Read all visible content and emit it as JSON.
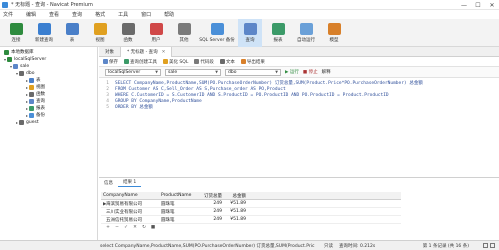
{
  "window": {
    "title": "* 无标题 - 查询 - Navicat Premium",
    "controls": [
      "—",
      "☐",
      "✕"
    ]
  },
  "menu": [
    "文件",
    "编辑",
    "查看",
    "查询",
    "格式",
    "工具",
    "窗口",
    "帮助"
  ],
  "toolbar": [
    {
      "label": "连接",
      "color": "#2e8b3e"
    },
    {
      "label": "新建查询",
      "color": "#3b7fd0"
    },
    {
      "label": "表",
      "color": "#4a7fc8"
    },
    {
      "label": "视图",
      "color": "#e0a020"
    },
    {
      "label": "函数",
      "color": "#6a6a6a"
    },
    {
      "label": "用户",
      "color": "#d04848"
    },
    {
      "label": "其他",
      "color": "#7a7a7a"
    },
    {
      "label": "SQL Server 备份",
      "color": "#4a8fd8"
    },
    {
      "label": "查询",
      "color": "#5c86c8"
    },
    {
      "label": "报表",
      "color": "#3b9a68"
    },
    {
      "label": "自动运行",
      "color": "#6aa0d8"
    },
    {
      "label": "模型",
      "color": "#d8802a"
    }
  ],
  "tree": [
    {
      "label": "本地数据库",
      "level": 0,
      "color": "#2e8b3e"
    },
    {
      "label": "localSqlServer",
      "level": 0,
      "color": "#2e8b3e"
    },
    {
      "label": "sale",
      "level": 1,
      "color": "#5c86c8"
    },
    {
      "label": "dbo",
      "level": 2,
      "color": "#6a6a6a"
    },
    {
      "label": "表",
      "level": 3,
      "color": "#4a7fc8"
    },
    {
      "label": "视图",
      "level": 3,
      "color": "#e0a020"
    },
    {
      "label": "函数",
      "level": 3,
      "color": "#6a6a6a"
    },
    {
      "label": "查询",
      "level": 3,
      "color": "#5c86c8"
    },
    {
      "label": "报表",
      "level": 3,
      "color": "#3b9a68"
    },
    {
      "label": "备份",
      "level": 3,
      "color": "#4a8fd8"
    },
    {
      "label": "guest",
      "level": 2,
      "color": "#6a6a6a"
    }
  ],
  "tabs": {
    "objects": "对象",
    "query": "* 无标题 - 查询"
  },
  "query_toolbar": [
    "保存",
    "查询创建工具",
    "美化 SQL",
    "代码段",
    "文本",
    "导出结果"
  ],
  "connection": {
    "server": "localSqlServer",
    "database": "sale",
    "schema": "dbo",
    "run": "▶ 运行",
    "stop": "■ 停止",
    "explain": "解释"
  },
  "code_lines": [
    "SELECT CompanyName,ProductName,SUM(PO.PurchaseOrderNumber) 订货总量,SUM(Product.Price*PO.PurchaseOrderNumber) 总金额",
    "FROM Customer AS C,Sell_Order AS S,Purchase_order AS PO,Product",
    "WHERE C.CustomerID = S.CustomerID AND S.ProductID = PO.ProductID AND PO.ProductID = Product.ProductID",
    "GROUP BY CompanyName,ProductName",
    "ORDER BY 总金额"
  ],
  "result_tabs": [
    "信息",
    "结果 1"
  ],
  "result_table": {
    "headers": [
      "CompanyName",
      "ProductName",
      "订货总量",
      "总金额"
    ],
    "rows": [
      [
        "海滨贸易有限公司",
        "圆珠笔",
        "249",
        "¥51.89"
      ],
      [
        "三川实业有限公司",
        "圆珠笔",
        "249",
        "¥51.89"
      ],
      [
        "五洲信托贸易公司",
        "圆珠笔",
        "249",
        "¥51.89"
      ]
    ]
  },
  "result_toolbar": [
    "+",
    "−",
    "✓",
    "✕",
    "↻",
    "■"
  ],
  "status": {
    "sql": "select CompanyName,ProductName,SUM(PO.PurchaseOrderNumber) 订货总量,SUM(Product.Pric",
    "mode": "只读",
    "time": "查询时间: 0.212s",
    "records": "第 1 条记录 (共 16 条)"
  }
}
